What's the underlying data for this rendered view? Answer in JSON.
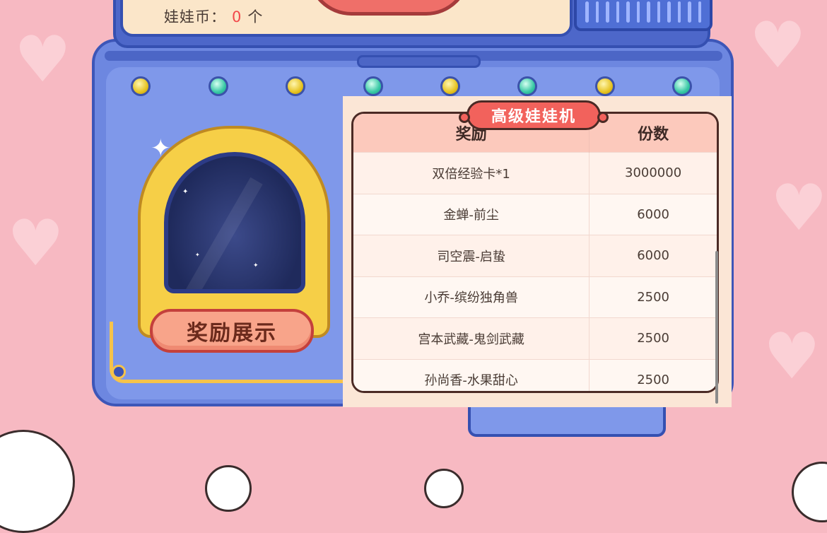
{
  "header": {
    "coin_label": "娃娃币：",
    "coin_value": "0",
    "coin_unit": "个"
  },
  "machine": {
    "show_button_label": "奖励展示"
  },
  "reward_panel": {
    "title": "高级娃娃机",
    "columns": [
      "奖励",
      "份数"
    ],
    "rows": [
      {
        "reward": "双倍经验卡*1",
        "count": "3000000"
      },
      {
        "reward": "金蝉-前尘",
        "count": "6000"
      },
      {
        "reward": "司空震-启蛰",
        "count": "6000"
      },
      {
        "reward": "小乔-缤纷独角兽",
        "count": "2500"
      },
      {
        "reward": "宫本武藏-鬼剑武藏",
        "count": "2500"
      },
      {
        "reward": "孙尚香-水果甜心",
        "count": "2500"
      }
    ]
  },
  "colors": {
    "background": "#f7b9c2",
    "machine_blue": "#6d87e0",
    "title_red": "#f2625c",
    "button_salmon": "#f8a48a",
    "coin_red": "#f2484a"
  },
  "icons": [
    "sparkle-icon",
    "indicator-light-icon",
    "heart-icon"
  ]
}
